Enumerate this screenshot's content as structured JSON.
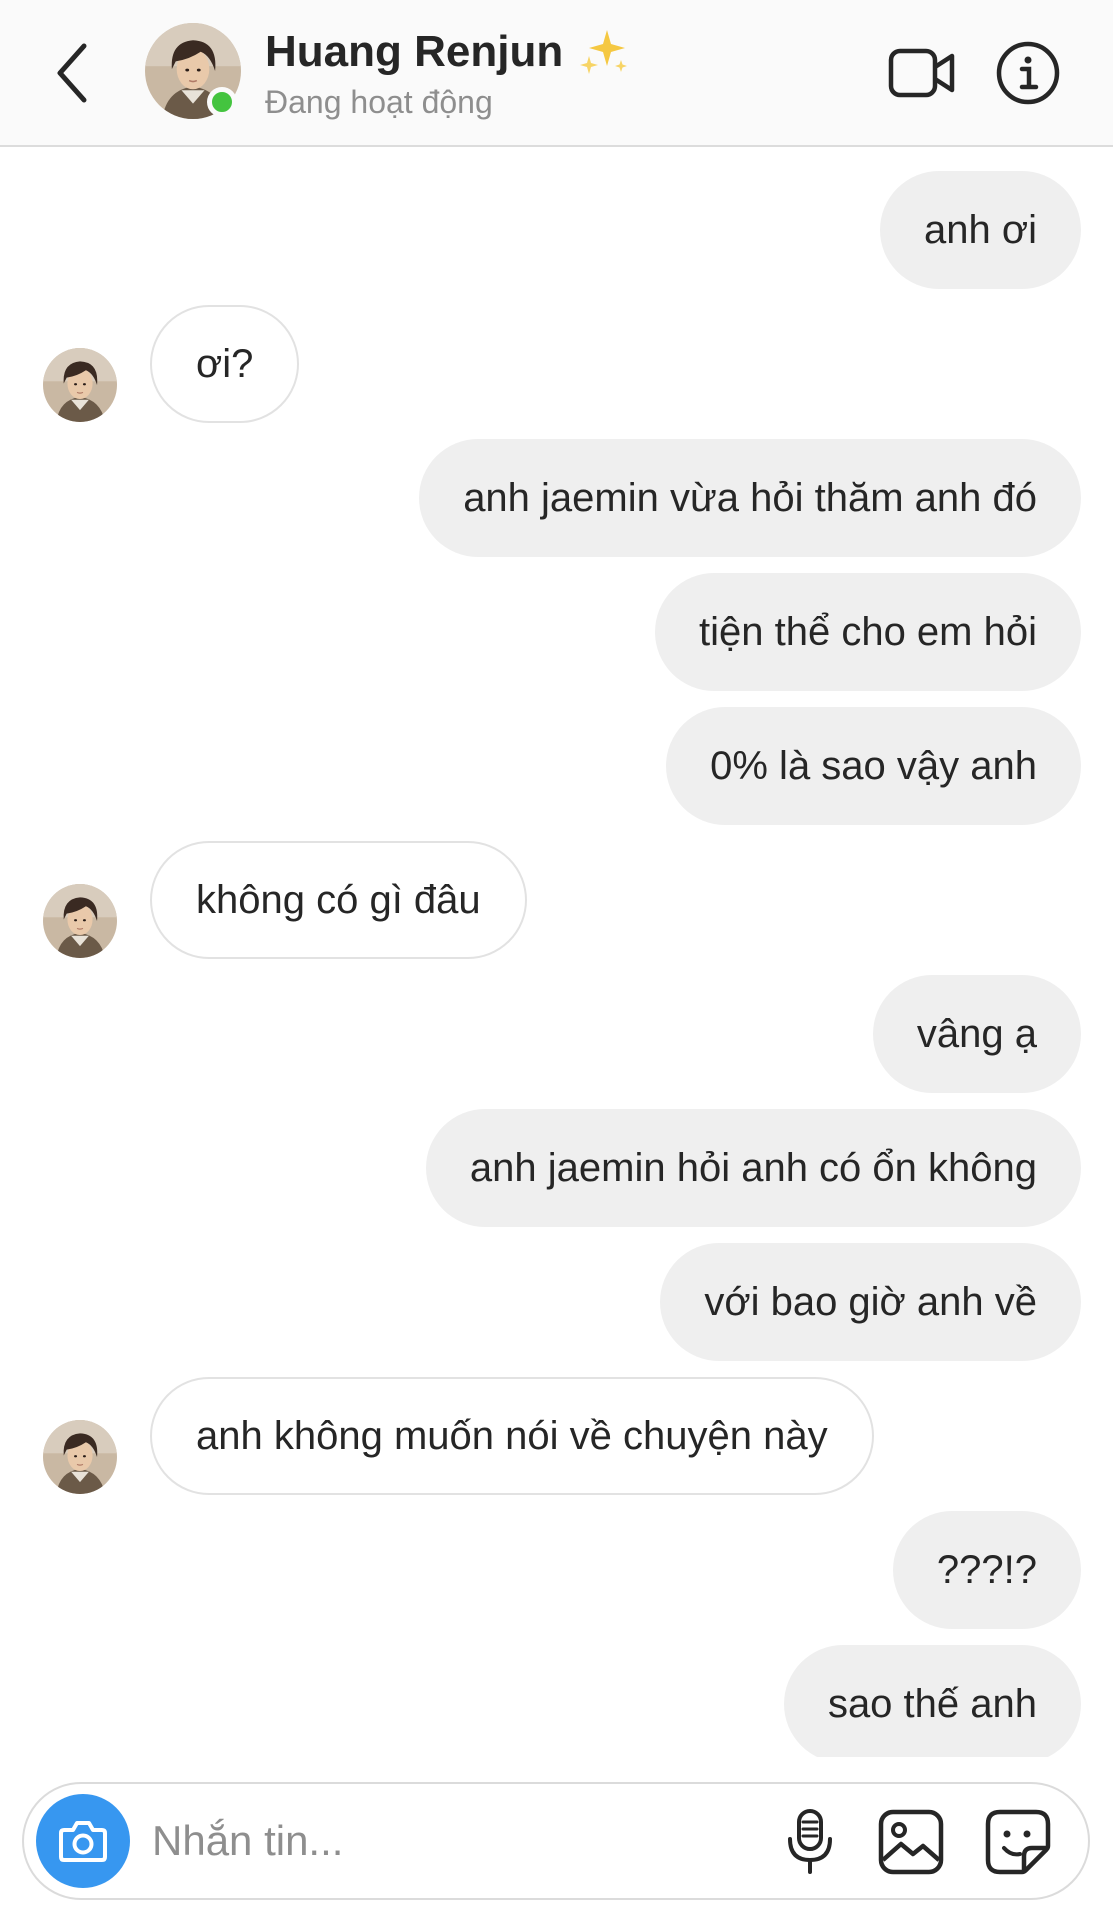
{
  "header": {
    "name": "Huang Renjun",
    "status": "Đang hoạt động"
  },
  "colors": {
    "accent": "#3797f0",
    "online": "#44c43f",
    "outgoing_bubble": "#efefef",
    "incoming_border": "#e2e2e2",
    "secondary_text": "#8e8e8e"
  },
  "icons": {
    "back": "chevron-left-icon",
    "video": "video-camera-icon",
    "info": "info-icon",
    "camera": "camera-icon",
    "mic": "microphone-icon",
    "gallery": "gallery-icon",
    "sticker": "sticker-icon",
    "emoji": "sparkles-icon"
  },
  "messages": [
    {
      "from": "me",
      "text": "anh ơi"
    },
    {
      "from": "them",
      "text": "ơi?"
    },
    {
      "from": "me",
      "text": "anh jaemin vừa hỏi thăm anh đó"
    },
    {
      "from": "me",
      "text": "tiện thể cho em hỏi"
    },
    {
      "from": "me",
      "text": "0% là sao vậy anh"
    },
    {
      "from": "them",
      "text": "không có gì đâu"
    },
    {
      "from": "me",
      "text": "vâng ạ"
    },
    {
      "from": "me",
      "text": "anh jaemin hỏi anh có ổn không"
    },
    {
      "from": "me",
      "text": "với bao giờ anh về"
    },
    {
      "from": "them",
      "text": "anh không muốn nói về chuyện này"
    },
    {
      "from": "me",
      "text": "???!?"
    },
    {
      "from": "me",
      "text": "sao thế anh"
    }
  ],
  "composer": {
    "placeholder": "Nhắn tin..."
  }
}
